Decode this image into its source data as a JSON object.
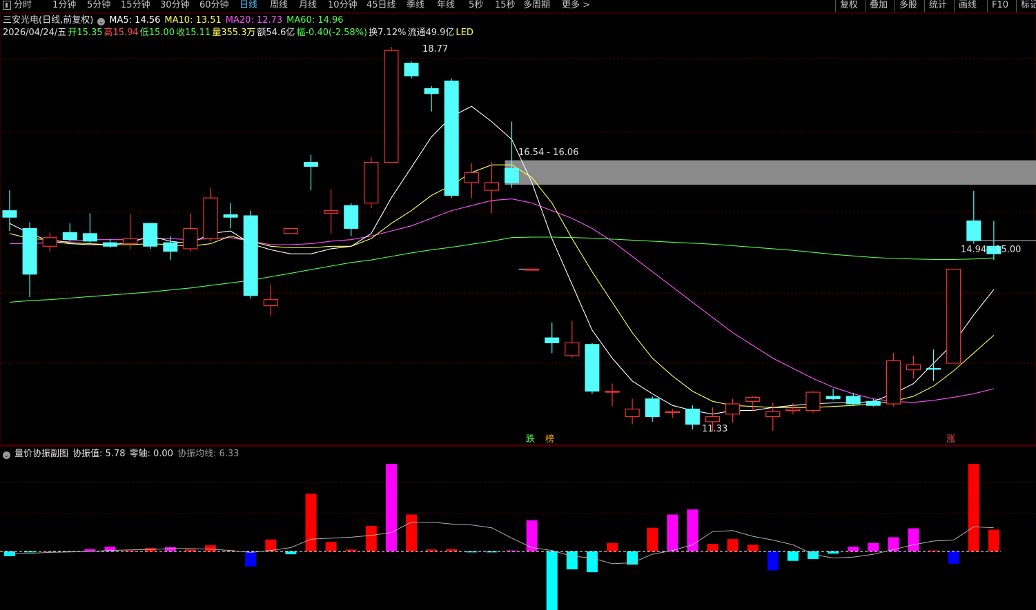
{
  "toolbar": {
    "tabs": [
      "分时",
      "1分钟",
      "5分钟",
      "15分钟",
      "30分钟",
      "60分钟",
      "日线",
      "周线",
      "月线",
      "10分钟",
      "45日线",
      "季线",
      "年线",
      "5秒",
      "15秒",
      "多周期",
      "更多 >"
    ],
    "active_tab": "日线",
    "right_buttons": [
      "复权",
      "叠加",
      "多股",
      "统计",
      "画线",
      "F10",
      "标记"
    ]
  },
  "info": {
    "stock": "三安光电(日线,前复权)",
    "ma5": "MA5: 14.56",
    "ma10": "MA10: 13.51",
    "ma20": "MA20: 12.73",
    "ma60": "MA60: 14.96",
    "date": "2026/04/24/五",
    "open": "开15.35",
    "high": "高15.94",
    "low": "低15.00",
    "close": "收15.11",
    "volume": "量355.3万",
    "amount": "额54.6亿",
    "change": "幅-0.40(-2.58%)",
    "turnover": "换7.12%",
    "float": "流通49.9亿",
    "sector": "LED"
  },
  "annotations": {
    "high_label": "18.77",
    "low_label": "11.33",
    "gap1": "16.54 - 16.06",
    "gap2": "14.94 - 15.00",
    "tag_die": "跌",
    "tag_bang": "榜",
    "tag_zhang": "涨"
  },
  "sub": {
    "title": "量价协振副图",
    "value": "协振值: 5.78",
    "zero": "零轴: 0.00",
    "avg": "协振均线: 6.33"
  },
  "colors": {
    "up": "#ff3232",
    "down": "#54fcfc",
    "ma5": "#ffffff",
    "ma10": "#ffff54",
    "ma20": "#ff54ff",
    "ma60": "#54ff54",
    "sub_red": "#ff0000",
    "sub_magenta": "#ff00ff",
    "sub_cyan": "#00ffff",
    "sub_blue": "#0000ff"
  },
  "chart_data": {
    "type": "candlestick",
    "price_range": [
      10.5,
      19.5
    ],
    "candles": [
      {
        "o": 15.55,
        "h": 15.95,
        "l": 15.15,
        "c": 15.42
      },
      {
        "o": 15.2,
        "h": 15.32,
        "l": 13.85,
        "c": 14.3
      },
      {
        "o": 14.85,
        "h": 15.12,
        "l": 14.75,
        "c": 15.02
      },
      {
        "o": 15.12,
        "h": 15.3,
        "l": 14.95,
        "c": 14.98
      },
      {
        "o": 15.1,
        "h": 15.5,
        "l": 14.92,
        "c": 14.95
      },
      {
        "o": 14.92,
        "h": 15.0,
        "l": 14.82,
        "c": 14.85
      },
      {
        "o": 14.9,
        "h": 15.48,
        "l": 14.8,
        "c": 15.0
      },
      {
        "o": 15.3,
        "h": 15.3,
        "l": 14.8,
        "c": 14.85
      },
      {
        "o": 14.92,
        "h": 15.05,
        "l": 14.58,
        "c": 14.75
      },
      {
        "o": 14.8,
        "h": 15.5,
        "l": 14.75,
        "c": 15.2
      },
      {
        "o": 15.0,
        "h": 16.0,
        "l": 14.95,
        "c": 15.8
      },
      {
        "o": 15.47,
        "h": 15.7,
        "l": 15.2,
        "c": 15.42
      },
      {
        "o": 15.45,
        "h": 15.55,
        "l": 13.82,
        "c": 13.88
      },
      {
        "o": 13.68,
        "h": 14.1,
        "l": 13.48,
        "c": 13.8
      },
      {
        "o": 15.1,
        "h": 15.2,
        "l": 15.1,
        "c": 15.2
      },
      {
        "o": 16.5,
        "h": 16.65,
        "l": 15.95,
        "c": 16.42
      },
      {
        "o": 15.5,
        "h": 15.97,
        "l": 15.1,
        "c": 15.55
      },
      {
        "o": 15.65,
        "h": 15.7,
        "l": 15.05,
        "c": 15.2
      },
      {
        "o": 15.7,
        "h": 16.6,
        "l": 15.6,
        "c": 16.5
      },
      {
        "o": 16.5,
        "h": 18.77,
        "l": 16.5,
        "c": 18.7
      },
      {
        "o": 18.45,
        "h": 18.48,
        "l": 18.15,
        "c": 18.2
      },
      {
        "o": 17.95,
        "h": 18.0,
        "l": 17.5,
        "c": 17.85
      },
      {
        "o": 18.1,
        "h": 18.15,
        "l": 15.8,
        "c": 15.85
      },
      {
        "o": 16.1,
        "h": 16.48,
        "l": 15.8,
        "c": 16.3
      },
      {
        "o": 15.95,
        "h": 16.5,
        "l": 15.5,
        "c": 16.1
      },
      {
        "o": 16.38,
        "h": 17.3,
        "l": 16.0,
        "c": 16.1
      },
      {
        "o": 14.4,
        "h": 14.4,
        "l": 14.4,
        "c": 14.4
      },
      {
        "o": 13.05,
        "h": 13.35,
        "l": 12.75,
        "c": 12.95
      },
      {
        "o": 12.7,
        "h": 13.38,
        "l": 12.65,
        "c": 12.95
      },
      {
        "o": 12.92,
        "h": 12.95,
        "l": 11.95,
        "c": 12.0
      },
      {
        "o": 12.0,
        "h": 12.15,
        "l": 11.7,
        "c": 12.0
      },
      {
        "o": 11.5,
        "h": 11.85,
        "l": 11.35,
        "c": 11.65
      },
      {
        "o": 11.85,
        "h": 11.9,
        "l": 11.4,
        "c": 11.5
      },
      {
        "o": 11.6,
        "h": 11.65,
        "l": 11.48,
        "c": 11.6
      },
      {
        "o": 11.65,
        "h": 11.72,
        "l": 11.25,
        "c": 11.35
      },
      {
        "o": 11.4,
        "h": 11.68,
        "l": 11.22,
        "c": 11.5
      },
      {
        "o": 11.55,
        "h": 11.85,
        "l": 11.38,
        "c": 11.75
      },
      {
        "o": 11.8,
        "h": 11.9,
        "l": 11.6,
        "c": 11.88
      },
      {
        "o": 11.5,
        "h": 11.78,
        "l": 11.22,
        "c": 11.6
      },
      {
        "o": 11.62,
        "h": 11.77,
        "l": 11.55,
        "c": 11.65
      },
      {
        "o": 11.62,
        "h": 12.0,
        "l": 11.58,
        "c": 11.98
      },
      {
        "o": 11.9,
        "h": 12.05,
        "l": 11.82,
        "c": 11.85
      },
      {
        "o": 11.9,
        "h": 11.97,
        "l": 11.73,
        "c": 11.75
      },
      {
        "o": 11.8,
        "h": 11.85,
        "l": 11.7,
        "c": 11.72
      },
      {
        "o": 11.75,
        "h": 12.75,
        "l": 11.7,
        "c": 12.6
      },
      {
        "o": 12.42,
        "h": 12.7,
        "l": 12.25,
        "c": 12.52
      },
      {
        "o": 12.45,
        "h": 12.82,
        "l": 12.2,
        "c": 12.43
      },
      {
        "o": 12.55,
        "h": 14.4,
        "l": 12.55,
        "c": 14.4
      },
      {
        "o": 15.35,
        "h": 15.94,
        "l": 14.9,
        "c": 14.96
      },
      {
        "o": 14.85,
        "h": 15.35,
        "l": 14.58,
        "c": 14.7
      }
    ],
    "ma5": [
      15.3,
      15.1,
      14.95,
      14.9,
      14.88,
      14.88,
      14.92,
      15.05,
      14.95,
      14.9,
      15.1,
      15.15,
      14.9,
      14.78,
      14.7,
      14.7,
      14.8,
      14.85,
      15.1,
      15.8,
      16.4,
      17.0,
      17.4,
      17.6,
      17.3,
      16.95,
      16.1,
      15.0,
      14.1,
      13.2,
      12.65,
      12.2,
      11.95,
      11.72,
      11.62,
      11.55,
      11.62,
      11.62,
      11.68,
      11.72,
      11.75,
      11.77,
      11.77,
      11.8,
      11.95,
      12.15,
      12.55,
      12.95,
      13.5,
      14.0
    ],
    "ma10": [
      15.1,
      15.0,
      14.98,
      14.92,
      14.9,
      14.88,
      14.88,
      14.9,
      14.88,
      14.85,
      14.9,
      15.05,
      14.95,
      14.85,
      14.82,
      14.82,
      14.85,
      14.85,
      15.0,
      15.3,
      15.55,
      15.85,
      16.05,
      16.3,
      16.45,
      16.45,
      16.2,
      15.7,
      15.0,
      14.35,
      13.75,
      13.15,
      12.65,
      12.3,
      12.0,
      11.8,
      11.72,
      11.7,
      11.68,
      11.68,
      11.68,
      11.7,
      11.72,
      11.75,
      11.8,
      11.9,
      12.1,
      12.4,
      12.75,
      13.1
    ],
    "ma20": [
      14.9,
      14.9,
      14.92,
      14.95,
      14.98,
      14.98,
      14.98,
      15.0,
      15.0,
      14.98,
      15.0,
      15.02,
      14.95,
      14.88,
      14.88,
      14.9,
      14.95,
      14.98,
      15.05,
      15.15,
      15.25,
      15.4,
      15.55,
      15.65,
      15.75,
      15.78,
      15.7,
      15.55,
      15.4,
      15.2,
      14.95,
      14.65,
      14.35,
      14.05,
      13.75,
      13.45,
      13.15,
      12.9,
      12.65,
      12.45,
      12.25,
      12.08,
      11.95,
      11.85,
      11.8,
      11.78,
      11.82,
      11.88,
      11.95,
      12.05
    ],
    "ma60": [
      13.75,
      13.78,
      13.8,
      13.83,
      13.86,
      13.89,
      13.92,
      13.95,
      13.99,
      14.03,
      14.08,
      14.13,
      14.18,
      14.25,
      14.32,
      14.39,
      14.46,
      14.53,
      14.58,
      14.65,
      14.72,
      14.78,
      14.83,
      14.89,
      14.95,
      15.02,
      15.03,
      15.03,
      15.02,
      15.01,
      14.99,
      14.97,
      14.95,
      14.93,
      14.91,
      14.89,
      14.86,
      14.83,
      14.8,
      14.77,
      14.73,
      14.69,
      14.66,
      14.63,
      14.61,
      14.6,
      14.59,
      14.59,
      14.6,
      14.62
    ],
    "sub_range": [
      -2.5,
      3.5
    ],
    "sub_bars": [
      {
        "v": -0.25,
        "c": "cyan"
      },
      {
        "v": -0.05,
        "c": "cyan"
      },
      {
        "v": 0.03,
        "c": "magenta"
      },
      {
        "v": -0.02,
        "c": "cyan"
      },
      {
        "v": 0.12,
        "c": "magenta"
      },
      {
        "v": 0.25,
        "c": "magenta"
      },
      {
        "v": 0.05,
        "c": "red"
      },
      {
        "v": 0.18,
        "c": "red"
      },
      {
        "v": 0.22,
        "c": "magenta"
      },
      {
        "v": 0.1,
        "c": "red"
      },
      {
        "v": 0.32,
        "c": "red"
      },
      {
        "v": 0.03,
        "c": "red"
      },
      {
        "v": -0.8,
        "c": "blue"
      },
      {
        "v": 0.63,
        "c": "red"
      },
      {
        "v": -0.15,
        "c": "cyan"
      },
      {
        "v": 3.05,
        "c": "red"
      },
      {
        "v": 0.5,
        "c": "red"
      },
      {
        "v": 0.1,
        "c": "red"
      },
      {
        "v": 1.35,
        "c": "red"
      },
      {
        "v": 4.63,
        "c": "magenta"
      },
      {
        "v": 1.95,
        "c": "red"
      },
      {
        "v": 0.1,
        "c": "red"
      },
      {
        "v": 0.12,
        "c": "red"
      },
      {
        "v": -0.05,
        "c": "cyan"
      },
      {
        "v": -0.05,
        "c": "cyan"
      },
      {
        "v": 0.05,
        "c": "magenta"
      },
      {
        "v": 1.65,
        "c": "magenta"
      },
      {
        "v": -3.2,
        "c": "cyan"
      },
      {
        "v": -0.95,
        "c": "cyan"
      },
      {
        "v": -1.1,
        "c": "cyan"
      },
      {
        "v": 0.45,
        "c": "red"
      },
      {
        "v": -0.7,
        "c": "cyan"
      },
      {
        "v": 1.25,
        "c": "red"
      },
      {
        "v": 1.95,
        "c": "magenta"
      },
      {
        "v": 2.22,
        "c": "magenta"
      },
      {
        "v": 0.4,
        "c": "red"
      },
      {
        "v": 0.65,
        "c": "red"
      },
      {
        "v": 0.35,
        "c": "red"
      },
      {
        "v": -1.0,
        "c": "blue"
      },
      {
        "v": -0.5,
        "c": "cyan"
      },
      {
        "v": -0.4,
        "c": "cyan"
      },
      {
        "v": -0.12,
        "c": "cyan"
      },
      {
        "v": 0.25,
        "c": "magenta"
      },
      {
        "v": 0.45,
        "c": "magenta"
      },
      {
        "v": 0.75,
        "c": "magenta"
      },
      {
        "v": 1.22,
        "c": "magenta"
      },
      {
        "v": 0.05,
        "c": "red"
      },
      {
        "v": -0.65,
        "c": "blue"
      },
      {
        "v": 4.63,
        "c": "red"
      },
      {
        "v": 1.15,
        "c": "red"
      }
    ],
    "sub_avg": [
      -0.1,
      -0.1,
      -0.05,
      -0.03,
      0.0,
      0.05,
      0.08,
      0.1,
      0.15,
      0.15,
      0.12,
      0.05,
      -0.05,
      0.05,
      0.2,
      0.65,
      0.7,
      0.75,
      0.85,
      1.0,
      1.55,
      1.55,
      1.45,
      1.4,
      1.25,
      0.7,
      0.2,
      0.05,
      -0.25,
      -0.35,
      -0.65,
      -0.6,
      -0.15,
      0.05,
      0.35,
      1.05,
      1.1,
      0.8,
      0.6,
      0.35,
      -0.15,
      -0.35,
      -0.3,
      -0.15,
      0.1,
      0.35,
      0.55,
      0.6,
      1.3,
      1.25
    ]
  }
}
